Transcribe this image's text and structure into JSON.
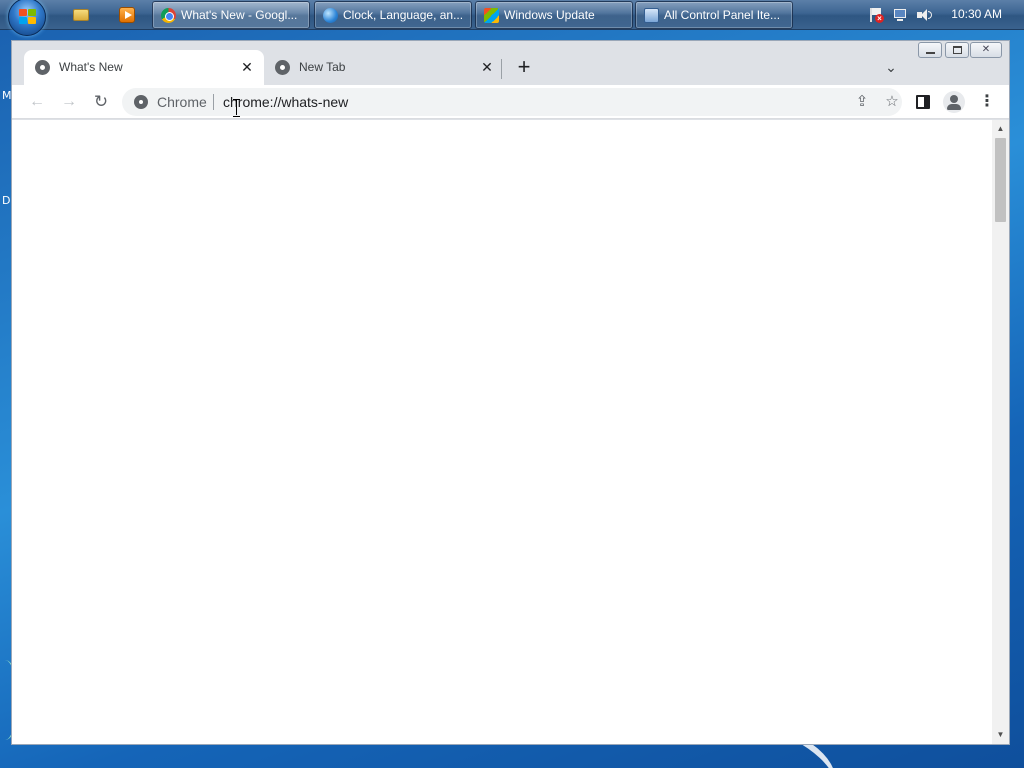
{
  "desktop": {
    "icon_label_1": "M",
    "icon_label_2": "D"
  },
  "taskbar": {
    "start_icon": "windows-start-orb",
    "pinned": [
      {
        "icon": "windows-explorer-icon"
      },
      {
        "icon": "media-player-icon"
      }
    ],
    "buttons": [
      {
        "label": "What's New - Googl...",
        "icon": "chrome-icon",
        "active": true
      },
      {
        "label": "Clock, Language, an...",
        "icon": "globe-icon",
        "active": false
      },
      {
        "label": "Windows Update",
        "icon": "windows-update-icon",
        "active": false
      },
      {
        "label": "All Control Panel Ite...",
        "icon": "control-panel-icon",
        "active": false
      }
    ],
    "tray": {
      "icons": [
        "action-center-flag-icon",
        "network-icon",
        "volume-icon"
      ],
      "clock": "10:30 AM"
    }
  },
  "browser": {
    "tabs": [
      {
        "title": "What's New",
        "active": true,
        "icon": "chrome-favicon"
      },
      {
        "title": "New Tab",
        "active": false,
        "icon": "chrome-favicon"
      }
    ],
    "new_tab_symbol": "+",
    "close_symbol": "✕",
    "tab_search_symbol": "⌄",
    "toolbar": {
      "back_symbol": "←",
      "forward_symbol": "→",
      "reload_symbol": "↻",
      "menu_symbol": "⋮",
      "star_symbol": "☆",
      "share_symbol": "⇪"
    },
    "omnibox": {
      "chip_label": "Chrome",
      "url": "chrome://whats-new"
    },
    "window_controls": {
      "close_symbol": "✕"
    }
  }
}
